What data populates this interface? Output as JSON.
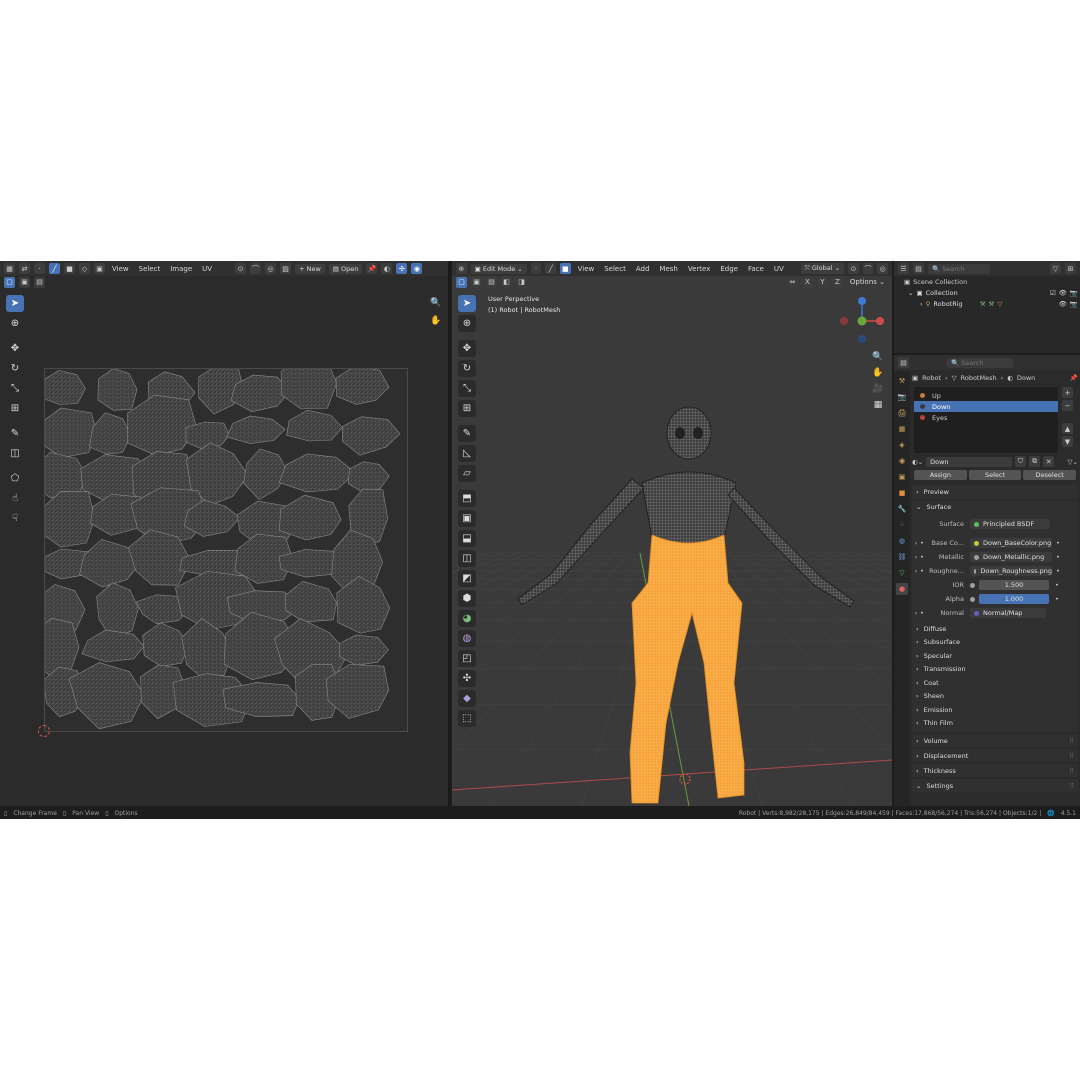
{
  "uv_header": {
    "menus": [
      "View",
      "Select",
      "Image",
      "UV"
    ],
    "new_label": "New",
    "open_label": "Open"
  },
  "viewport_header": {
    "mode": "Edit Mode",
    "menus": [
      "View",
      "Select",
      "Add",
      "Mesh",
      "Vertex",
      "Edge",
      "Face",
      "UV"
    ],
    "orientation": "Global",
    "axes": [
      "X",
      "Y",
      "Z"
    ],
    "options_label": "Options",
    "view_name": "User Perpective",
    "object_line": "(1) Robot | RobotMesh"
  },
  "outliner": {
    "search_placeholder": "Search",
    "scene_collection": "Scene Collection",
    "collection": "Collection",
    "item": "RobotRig"
  },
  "properties": {
    "search_placeholder": "Search",
    "breadcrumb": [
      "Robot",
      "RobotMesh",
      "Down"
    ],
    "slots": [
      "Up",
      "Down",
      "Eyes"
    ],
    "material_name": "Down",
    "assign_label": "Assign",
    "select_label": "Select",
    "deselect_label": "Deselect",
    "preview_label": "Preview",
    "surface_panel_label": "Surface",
    "surface_field_label": "Surface",
    "surface_shader": "Principled BSDF",
    "inputs": [
      {
        "label": "Base Co...",
        "value": "Down_BaseColor.png",
        "dot": "#c8c838"
      },
      {
        "label": "Metallic",
        "value": "Down_Metallic.png",
        "dot": "#a0a0a0"
      },
      {
        "label": "Roughne...",
        "value": "Down_Roughness.png",
        "dot": "#a0a0a0"
      }
    ],
    "ior_label": "IOR",
    "ior_value": "1.500",
    "alpha_label": "Alpha",
    "alpha_value": "1.000",
    "normal_label": "Normal",
    "normal_value": "Normal/Map",
    "subsections": [
      "Diffuse",
      "Subsurface",
      "Specular",
      "Transmission",
      "Coat",
      "Sheen",
      "Emission",
      "Thin Film"
    ],
    "panels": [
      "Volume",
      "Displacement",
      "Thickness",
      "Settings"
    ]
  },
  "statusbar": {
    "hint1": "Change Frame",
    "hint2": "Pan View",
    "hint3": "Options",
    "stats": "Robot | Verts:8,982/28,175 | Edges:26,849/84,459 | Faces:17,868/56,274 | Tris:56,274 | Objects:1/2 |",
    "version": "4.5.1"
  },
  "colors": {
    "accent": "#4772b3",
    "selection": "#f5a33a",
    "background": "#2b2b2b"
  }
}
